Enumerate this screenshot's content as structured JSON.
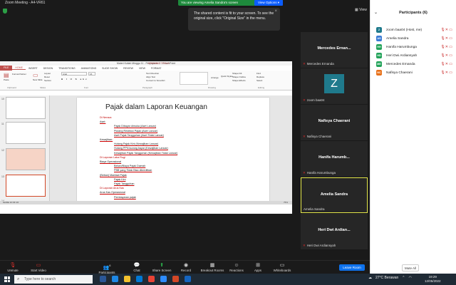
{
  "window": {
    "title": "Zoom Meeting - A4-VR61"
  },
  "banner": {
    "text": "You are viewing Amelia Sandra's screen",
    "options": "View Options ▾"
  },
  "view_label": "View",
  "toast": {
    "text": "The shared content is fit to your screen. To see the original size, click \"Original Size\" in the menu."
  },
  "ppt": {
    "window_title": "Materi Kuliah Minggu 11 - Perpajakan 2 - PowerPoint",
    "drawing_tools": "DRAWING TOOLS",
    "tabs": [
      "FILE",
      "HOME",
      "INSERT",
      "DESIGN",
      "TRANSITIONS",
      "ANIMATIONS",
      "SLIDE SHOW",
      "REVIEW",
      "VIEW",
      "FORMAT"
    ],
    "ribbon_groups": [
      "Clipboard",
      "Slides",
      "Font",
      "Paragraph",
      "Drawing",
      "Editing"
    ],
    "ribbon_items": {
      "paste": "Paste",
      "new_slide": "New Slide",
      "section": "Section",
      "layout": "Layout",
      "reset": "Reset",
      "format_painter": "Format Painter",
      "font": "Arial",
      "size": "16",
      "text_direction": "Text Direction",
      "align_text": "Align Text",
      "convert_smartart": "Convert to SmartArt",
      "arrange": "Arrange",
      "quick_styles": "Quick Styles",
      "shape_fill": "Shape Fill",
      "shape_outline": "Shape Outline",
      "shape_effects": "Shape Effects",
      "find": "Find",
      "replace": "Replace",
      "select": "Select"
    },
    "thumb_numbers": [
      "10",
      "11",
      "12",
      "13",
      "14"
    ],
    "slide_title": "Pajak dalam Laporan Keuangan",
    "slide_lines": [
      {
        "text": "Di Neraca",
        "indent": 0,
        "style": "red"
      },
      {
        "text": "Aset:",
        "indent": 0,
        "style": "u"
      },
      {
        "text": "Pajak Dibayar dimuka (Aset Lancar)",
        "indent": 1,
        "style": "u"
      },
      {
        "text": "Piutang Restitusi Pajak (Aset Lancar)",
        "indent": 1,
        "style": "u"
      },
      {
        "text": "Aset Pajak Tangguhan (Aset Tidak Lancar)",
        "indent": 1,
        "style": "u"
      },
      {
        "text": "Kewajiban:",
        "indent": 0,
        "style": "u"
      },
      {
        "text": "Hutang Pajak Kini (Kewajiban Lancar)",
        "indent": 1,
        "style": "u"
      },
      {
        "text": "Hutang PPN kurang bayar (Kewajiban Lancar)",
        "indent": 1,
        "style": "u"
      },
      {
        "text": "Kewajiban Pajak Tangguhan (Kewajiban Tidak Lancar)",
        "indent": 1,
        "style": "u"
      },
      {
        "text": "Di Laporan Laba Rugi",
        "indent": 0,
        "style": "red"
      },
      {
        "text": "Biaya Operasional",
        "indent": 0,
        "style": "u"
      },
      {
        "text": "Beban/Biaya Pajak Daerah",
        "indent": 1,
        "style": "u"
      },
      {
        "text": "PBB yang Tidak Bisa dikreditkan",
        "indent": 1,
        "style": "u"
      },
      {
        "text": "(Beban) Manfaat Pajak",
        "indent": 0,
        "style": "u"
      },
      {
        "text": "Pajak Kini",
        "indent": 1,
        "style": "u"
      },
      {
        "text": "Pajak Tangguhan",
        "indent": 1,
        "style": "u"
      },
      {
        "text": "Di Laporan Arus Kas",
        "indent": 0,
        "style": "red"
      },
      {
        "text": "Arus Kas Operasional",
        "indent": 0,
        "style": "u"
      },
      {
        "text": "Pembayaran pajak",
        "indent": 1,
        "style": "u"
      }
    ],
    "status": "SLIDE 13 OF 16",
    "zoom": "75%"
  },
  "gallery": [
    {
      "name": "Mercedes  Ernan...",
      "label": "Mercedes Ernanda",
      "video": false
    },
    {
      "name": "Z",
      "label": "zoom baa04",
      "video": false,
      "avatar": true
    },
    {
      "name": "Nafisya Chaerani",
      "label": "Nafisya Chaerani",
      "video": false
    },
    {
      "name": "Hanifa  Harumb...",
      "label": "Hanifa Harumbunga",
      "video": false
    },
    {
      "name": "Amelia Sandra",
      "label": "Amelia Sandra",
      "video": false,
      "active": true
    },
    {
      "name": "Heri  Dwi  Ardian...",
      "label": "Heri Dwi Ardiansyah",
      "video": false
    }
  ],
  "participants": {
    "title": "Participants (6)",
    "people": [
      {
        "initials": "Z",
        "name": "zoom baa04 (Host, me)",
        "color": "#1f7a8c"
      },
      {
        "initials": "AS",
        "name": "Amelia Sandra",
        "color": "#3a7bd5"
      },
      {
        "initials": "HH",
        "name": "Hanifa Harumbunga",
        "color": "#23a35a"
      },
      {
        "initials": "HD",
        "name": "Heri Dwi Ardiansyah",
        "color": "#23a35a"
      },
      {
        "initials": "ME",
        "name": "Mercedes Ernanda",
        "color": "#23a35a"
      },
      {
        "initials": "NC",
        "name": "Nafisya Chaerani",
        "color": "#e8711a"
      }
    ],
    "mute_all": "Mute All"
  },
  "toolbar": {
    "unmute": "Unmute",
    "start_video": "Start Video",
    "participants": "Participants",
    "participants_count": "6",
    "chat": "Chat",
    "share_screen": "Share Screen",
    "record": "Record",
    "breakout": "Breakout Rooms",
    "reactions": "Reactions",
    "apps": "Apps",
    "whiteboards": "Whiteboards",
    "leave": "Leave Room"
  },
  "taskbar": {
    "search": "Type here to search",
    "weather": "27°C  Berawan",
    "time": "19:29",
    "date": "12/05/2022"
  }
}
